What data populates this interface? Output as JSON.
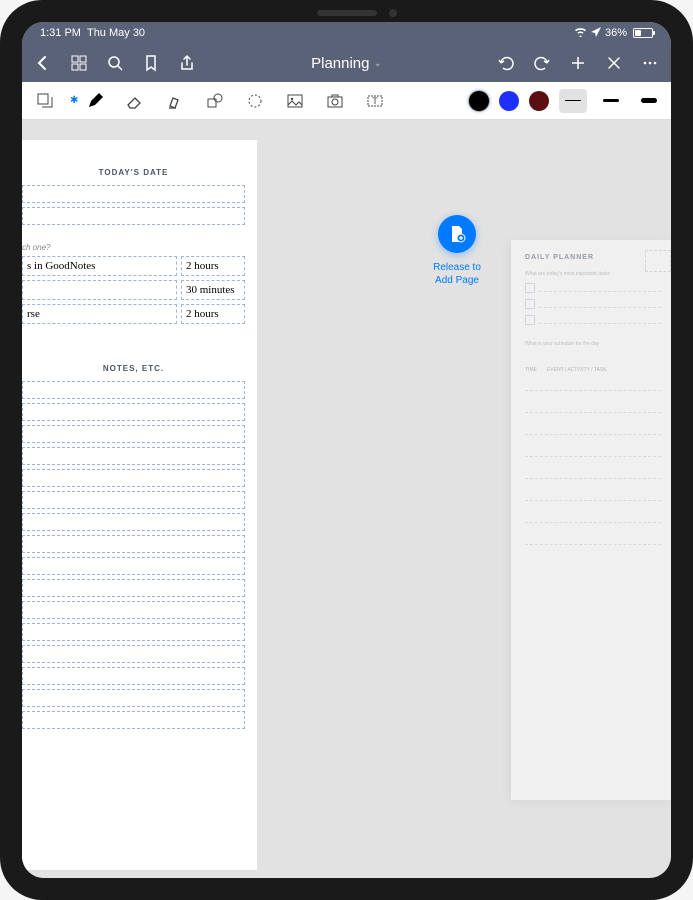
{
  "status": {
    "time": "1:31 PM",
    "date": "Thu May 30",
    "battery_pct": "36%"
  },
  "nav": {
    "title": "Planning"
  },
  "colors": {
    "black": "#000000",
    "blue": "#1e30ff",
    "darkred": "#5a1010"
  },
  "page": {
    "date_header": "TODAY'S DATE",
    "prompt": "ch one?",
    "tasks": [
      {
        "text": "s in GoodNotes",
        "time": "2 hours"
      },
      {
        "text": "",
        "time": "30 minutes"
      },
      {
        "text": "rse",
        "time": "2 hours"
      }
    ],
    "notes_header": "NOTES, ETC."
  },
  "add_page": {
    "label_line1": "Release to",
    "label_line2": "Add Page"
  },
  "drag": {
    "title": "DAILY PLANNER",
    "sub1": "What are today's most important tasks",
    "sub2": "What is your schedule for the day",
    "col1": "TIME",
    "col2": "EVENT / ACTIVITY / TASK"
  }
}
